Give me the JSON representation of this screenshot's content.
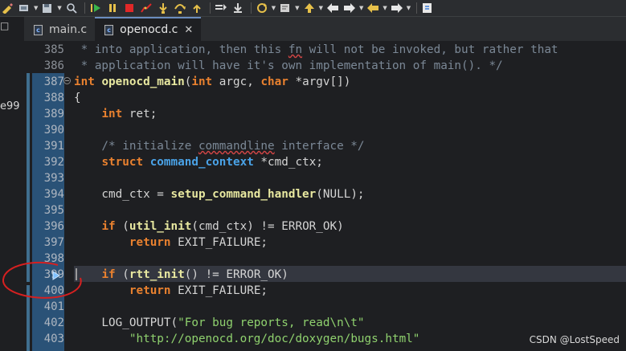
{
  "tabs": [
    {
      "label": "main.c",
      "icon": "c-file-icon",
      "icon_letter": "c",
      "active": false
    },
    {
      "label": "openocd.c",
      "icon": "c-file-icon",
      "icon_letter": "c",
      "active": true,
      "close": "✕"
    }
  ],
  "left_panel": {
    "fragment": "e99",
    "tab_glyph": "□"
  },
  "watermark": "CSDN @LostSpeed",
  "colors": {
    "keyword": "#e9812f",
    "function": "#e8e8a0",
    "type": "#4aa3e8",
    "comment": "#7b8896",
    "string": "#8fd16e",
    "gutter": "#2a5277",
    "annotation_red": "#d62020"
  },
  "editor": {
    "lines": [
      {
        "num": "385",
        "segs": [
          {
            "t": " * into application, then this ",
            "c": "cm"
          },
          {
            "t": "fn",
            "c": "cm sq"
          },
          {
            "t": " will not be invoked, but rather that",
            "c": "cm"
          }
        ]
      },
      {
        "num": "386",
        "segs": [
          {
            "t": " * application will have it's own implementation of main(). */",
            "c": "cm"
          }
        ]
      },
      {
        "num": "387",
        "segs": [
          {
            "t": "int",
            "c": "kw"
          },
          {
            "t": " "
          },
          {
            "t": "openocd_main",
            "c": "fn"
          },
          {
            "t": "("
          },
          {
            "t": "int",
            "c": "kw"
          },
          {
            "t": " argc, "
          },
          {
            "t": "char",
            "c": "kw"
          },
          {
            "t": " *argv[])"
          }
        ]
      },
      {
        "num": "388",
        "segs": [
          {
            "t": "{"
          }
        ]
      },
      {
        "num": "389",
        "segs": [
          {
            "t": "    "
          },
          {
            "t": "int",
            "c": "kw"
          },
          {
            "t": " ret;"
          }
        ]
      },
      {
        "num": "390",
        "segs": []
      },
      {
        "num": "391",
        "segs": [
          {
            "t": "    /* initialize ",
            "c": "cm"
          },
          {
            "t": "commandline",
            "c": "cm sq"
          },
          {
            "t": " interface */",
            "c": "cm"
          }
        ]
      },
      {
        "num": "392",
        "segs": [
          {
            "t": "    "
          },
          {
            "t": "struct",
            "c": "kw"
          },
          {
            "t": " "
          },
          {
            "t": "command_context",
            "c": "ty"
          },
          {
            "t": " *cmd_ctx;"
          }
        ]
      },
      {
        "num": "393",
        "segs": []
      },
      {
        "num": "394",
        "segs": [
          {
            "t": "    cmd_ctx = "
          },
          {
            "t": "setup_command_handler",
            "c": "fn"
          },
          {
            "t": "(NULL);"
          }
        ]
      },
      {
        "num": "395",
        "segs": []
      },
      {
        "num": "396",
        "segs": [
          {
            "t": "    "
          },
          {
            "t": "if",
            "c": "kw"
          },
          {
            "t": " ("
          },
          {
            "t": "util_init",
            "c": "fn"
          },
          {
            "t": "(cmd_ctx) != ERROR_OK)"
          }
        ]
      },
      {
        "num": "397",
        "segs": [
          {
            "t": "        "
          },
          {
            "t": "return",
            "c": "kw"
          },
          {
            "t": " EXIT_FAILURE;"
          }
        ]
      },
      {
        "num": "398",
        "segs": []
      },
      {
        "num": "399",
        "segs": [
          {
            "t": "    "
          },
          {
            "t": "if",
            "c": "kw"
          },
          {
            "t": " ("
          },
          {
            "t": "rtt_init",
            "c": "fn"
          },
          {
            "t": "() != ERROR_OK)"
          }
        ]
      },
      {
        "num": "400",
        "segs": [
          {
            "t": "        "
          },
          {
            "t": "return",
            "c": "kw"
          },
          {
            "t": " EXIT_FAILURE;"
          }
        ]
      },
      {
        "num": "401",
        "segs": []
      },
      {
        "num": "402",
        "segs": [
          {
            "t": "    LOG_OUTPUT("
          },
          {
            "t": "\"For bug reports, read\\n\\t\"",
            "c": "st"
          }
        ]
      },
      {
        "num": "403",
        "segs": [
          {
            "t": "        "
          },
          {
            "t": "\"http://openocd.org/doc/doxygen/bugs.html\"",
            "c": "st"
          }
        ]
      }
    ],
    "current_line": "399"
  },
  "toolbar_icons": [
    "edit-icon",
    "run-config-icon",
    "save-icon",
    "search-icon",
    "resume-icon",
    "suspend-icon",
    "terminate-icon",
    "disconnect-icon",
    "step-into-icon",
    "step-over-icon",
    "step-return-icon",
    "instruction-step-icon",
    "drop-frame-icon",
    "refresh-icon",
    "debug-view-icon",
    "up-icon",
    "back-icon",
    "forward-icon",
    "prev-edit-icon",
    "next-icon",
    "help-icon"
  ]
}
